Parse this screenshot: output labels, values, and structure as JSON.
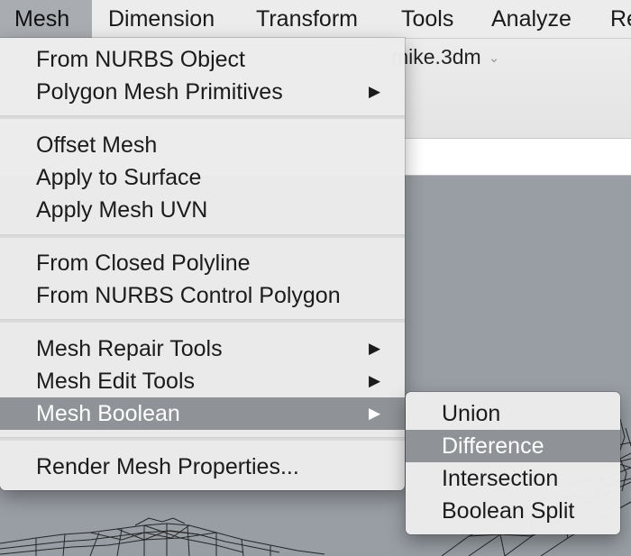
{
  "menubar": {
    "items": [
      {
        "label": "Mesh"
      },
      {
        "label": "Dimension"
      },
      {
        "label": "Transform"
      },
      {
        "label": "Tools"
      },
      {
        "label": "Analyze"
      },
      {
        "label": "Re"
      }
    ]
  },
  "document": {
    "title": "mike.3dm",
    "chevron": "⌄"
  },
  "menu": {
    "items": [
      {
        "label": "From NURBS Object"
      },
      {
        "label": "Polygon Mesh Primitives",
        "arrow": "▶"
      },
      {
        "label": "Offset Mesh"
      },
      {
        "label": "Apply to Surface"
      },
      {
        "label": "Apply Mesh UVN"
      },
      {
        "label": "From Closed Polyline"
      },
      {
        "label": "From NURBS Control Polygon"
      },
      {
        "label": "Mesh Repair Tools",
        "arrow": "▶"
      },
      {
        "label": "Mesh Edit Tools",
        "arrow": "▶"
      },
      {
        "label": "Mesh Boolean",
        "arrow": "▶"
      },
      {
        "label": "Render Mesh Properties..."
      }
    ]
  },
  "submenu": {
    "items": [
      {
        "label": "Union"
      },
      {
        "label": "Difference"
      },
      {
        "label": "Intersection"
      },
      {
        "label": "Boolean Split"
      }
    ]
  },
  "colors": {
    "highlight": "#8f9296",
    "menu_bg": "#ececec",
    "viewport_bg": "#999ea4"
  }
}
